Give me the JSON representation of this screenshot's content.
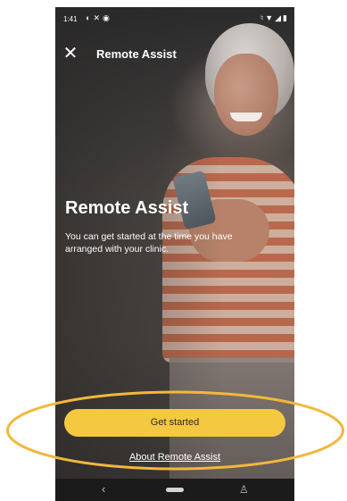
{
  "status_bar": {
    "time": "1:41",
    "left_icons": [
      "circle-icon",
      "x-icon",
      "clock-icon"
    ],
    "right_icons": [
      "mute-icon",
      "wifi-icon",
      "signal-icon",
      "battery-icon"
    ]
  },
  "header": {
    "title": "Remote Assist"
  },
  "hero": {
    "title": "Remote Assist",
    "description": "You can get started at the time you have arranged with your clinic."
  },
  "actions": {
    "primary_label": "Get started",
    "secondary_link": "About Remote Assist"
  },
  "colors": {
    "accent": "#f5c842",
    "highlight": "#f2b83a"
  }
}
